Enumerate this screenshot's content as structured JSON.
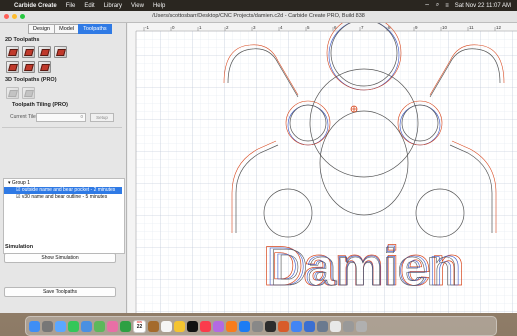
{
  "menubar": {
    "app": "Carbide Create",
    "items": [
      "File",
      "Edit",
      "Library",
      "View",
      "Help"
    ],
    "clock": "Sat Nov 22  11:07 AM"
  },
  "window": {
    "title": "/Users/scottosbarr/Desktop/CNC Projects/damien.c2d - Carbide Create PRO, Build 838"
  },
  "tabs": [
    "Design",
    "Model",
    "Toolpaths"
  ],
  "active_tab": "Toolpaths",
  "sections": {
    "toolpaths_2d": "2D Toolpaths",
    "toolpaths_3d": "3D Toolpaths (PRO)",
    "tiling": "Toolpath Tiling (PRO)",
    "simulation": "Simulation"
  },
  "tiling": {
    "current_tile_label": "Current Tile",
    "current_tile_value": "0",
    "setup_label": "Setup"
  },
  "toolpath_list": {
    "group": "Group 1",
    "items": [
      "outside name and bear pocket - 2 minutes",
      "v30 name and bear outline - 5 minutes"
    ],
    "selected": 0
  },
  "buttons": {
    "show_simulation": "Show Simulation",
    "save_toolpaths": "Save Toolpaths"
  },
  "ruler": {
    "ticks": [
      "-1",
      "0",
      "1",
      "2",
      "3",
      "4",
      "5",
      "6",
      "7",
      "8",
      "9",
      "10",
      "11",
      "12",
      "13"
    ]
  },
  "design": {
    "name_text": "Damien"
  },
  "dock": {
    "calendar_month": "NOV",
    "calendar_day": "22"
  },
  "colors": {
    "accent": "#2f7ae5",
    "pocket_path": "#d8481e",
    "vcarve_path": "#3a57c8",
    "outline": "#555555"
  }
}
